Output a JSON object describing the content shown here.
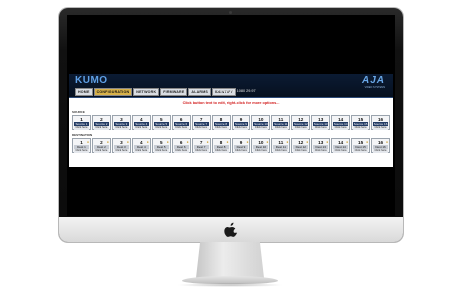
{
  "app": {
    "logo": "KUMO",
    "brand": "AJA",
    "brand_sub": "VIDEO SYSTEMS",
    "nav_tabs": [
      "HOME",
      "CONFIGURATION",
      "NETWORK",
      "FIRMWARE",
      "ALARMS",
      "IDENTIFY"
    ],
    "active_tab": "CONFIGURATION",
    "reference": "Reference: 1080 29.97",
    "instruction": "Click button text to edit, right-click for more options...",
    "source_label": "SOURCE",
    "destination_label": "DESTINATION",
    "sources": [
      {
        "num": "1",
        "name": "Source 1",
        "click": "Click here"
      },
      {
        "num": "2",
        "name": "Source 2",
        "click": "Click here"
      },
      {
        "num": "3",
        "name": "Source 3",
        "click": "Click here"
      },
      {
        "num": "4",
        "name": "Source 4",
        "click": "Click here"
      },
      {
        "num": "5",
        "name": "Source 5",
        "click": "Click here"
      },
      {
        "num": "6",
        "name": "Source 6",
        "click": "Click here"
      },
      {
        "num": "7",
        "name": "Source 7",
        "click": "Click here"
      },
      {
        "num": "8",
        "name": "Source 8",
        "click": "Click here"
      },
      {
        "num": "9",
        "name": "Source 9",
        "click": "Click here"
      },
      {
        "num": "10",
        "name": "Source 10",
        "click": "Click here"
      },
      {
        "num": "11",
        "name": "Source 11",
        "click": "Click here"
      },
      {
        "num": "12",
        "name": "Source 12",
        "click": "Click here"
      },
      {
        "num": "13",
        "name": "Source 13",
        "click": "Click here"
      },
      {
        "num": "14",
        "name": "Source 14",
        "click": "Click here"
      },
      {
        "num": "15",
        "name": "Source 15",
        "click": "Click here"
      },
      {
        "num": "16",
        "name": "Source 16",
        "click": "Click here"
      }
    ],
    "destinations": [
      {
        "num": "1",
        "name": "Dest 1",
        "click": "Click here"
      },
      {
        "num": "2",
        "name": "Dest 2",
        "click": "Click here"
      },
      {
        "num": "3",
        "name": "Dest 3",
        "click": "Click here"
      },
      {
        "num": "4",
        "name": "Dest 4",
        "click": "Click here"
      },
      {
        "num": "5",
        "name": "Dest 5",
        "click": "Click here"
      },
      {
        "num": "6",
        "name": "Dest 6",
        "click": "Click here"
      },
      {
        "num": "7",
        "name": "Dest 7",
        "click": "Click here"
      },
      {
        "num": "8",
        "name": "Dest 8",
        "click": "Click here"
      },
      {
        "num": "9",
        "name": "Dest 9",
        "click": "Click here"
      },
      {
        "num": "10",
        "name": "Dest 10",
        "click": "Click here"
      },
      {
        "num": "11",
        "name": "Dest 11",
        "click": "Click here"
      },
      {
        "num": "12",
        "name": "Dest 12",
        "click": "Click here"
      },
      {
        "num": "13",
        "name": "Dest 13",
        "click": "Click here"
      },
      {
        "num": "14",
        "name": "Dest 14",
        "click": "Click here"
      },
      {
        "num": "15",
        "name": "Dest 15",
        "click": "Click here"
      },
      {
        "num": "16",
        "name": "Dest 16",
        "click": "Click here"
      }
    ]
  },
  "icons": {
    "lock": "lock-icon",
    "apple": "apple-logo-icon"
  },
  "colors": {
    "header_bg": "#0b1b33",
    "logo": "#5fa0e6",
    "active_tab": "#d8b24a",
    "instruction": "#d21d1d",
    "source_name_bg": "#223a63"
  }
}
